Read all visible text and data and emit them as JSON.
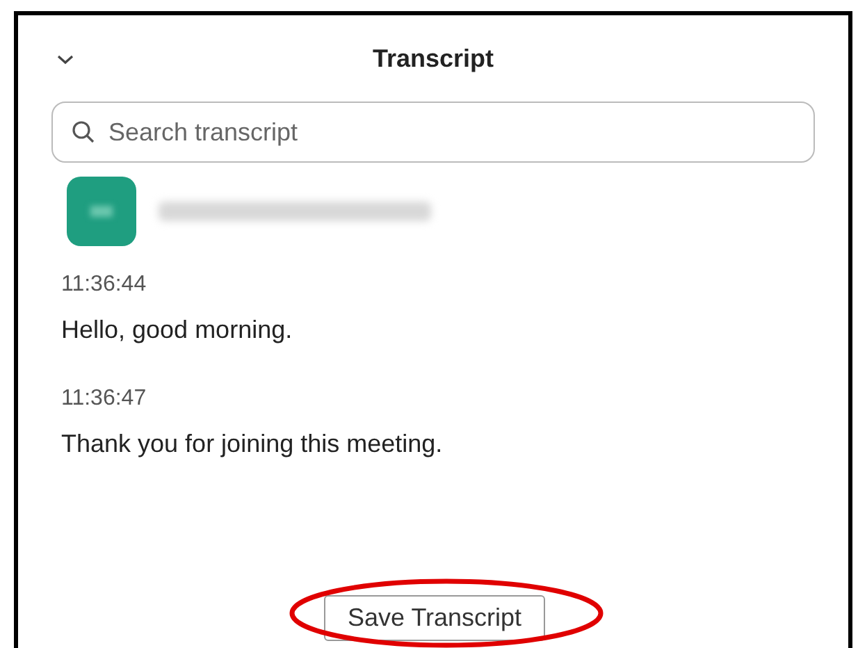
{
  "panel": {
    "title": "Transcript"
  },
  "search": {
    "placeholder": "Search transcript"
  },
  "messages": [
    {
      "time": "11:36:44",
      "text": "Hello, good morning."
    },
    {
      "time": "11:36:47",
      "text": "Thank you for joining this meeting."
    }
  ],
  "save_button": {
    "label": "Save Transcript",
    "highlighted": true
  }
}
